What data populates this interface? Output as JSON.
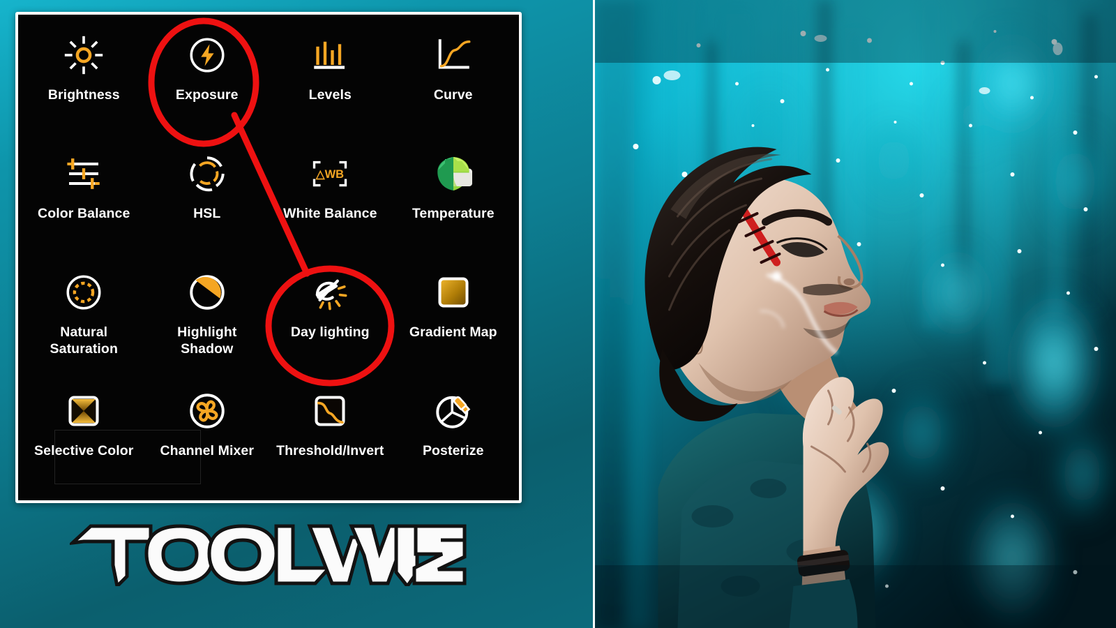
{
  "app": {
    "brand_name": "TOOLWIZ",
    "background_color": "#0d7f93",
    "panel_background": "#040404",
    "panel_border_color": "#ffffff",
    "accent_color": "#f5a623",
    "annotation_color": "#ee1111",
    "label_color": "#fdfdfd"
  },
  "tool_panel": {
    "tools": [
      {
        "label": "Brightness",
        "icon": "brightness-sun-icon",
        "highlighted": false
      },
      {
        "label": "Exposure",
        "icon": "exposure-bolt-icon",
        "highlighted": true
      },
      {
        "label": "Levels",
        "icon": "levels-histogram-icon",
        "highlighted": false
      },
      {
        "label": "Curve",
        "icon": "curve-graph-icon",
        "highlighted": false
      },
      {
        "label": "Color Balance",
        "icon": "sliders-icon",
        "highlighted": false
      },
      {
        "label": "HSL",
        "icon": "hsl-color-wheel-icon",
        "highlighted": false
      },
      {
        "label": "White Balance",
        "icon": "awb-bracket-icon",
        "highlighted": false
      },
      {
        "label": "Temperature",
        "icon": "snapseed-leaf-icon",
        "highlighted": false
      },
      {
        "label": "Natural\nSaturation",
        "icon": "dotted-circle-icon",
        "highlighted": false
      },
      {
        "label": "Highlight\nShadow",
        "icon": "half-filled-circle-icon",
        "highlighted": false
      },
      {
        "label": "Day lighting",
        "icon": "day-lighting-sun-icon",
        "highlighted": true
      },
      {
        "label": "Gradient Map",
        "icon": "gradient-square-icon",
        "highlighted": false
      },
      {
        "label": "Selective Color",
        "icon": "hourglass-square-icon",
        "highlighted": false
      },
      {
        "label": "Channel Mixer",
        "icon": "triskelion-circle-icon",
        "highlighted": false
      },
      {
        "label": "Threshold/Invert",
        "icon": "threshold-curve-square-icon",
        "highlighted": false
      },
      {
        "label": "Posterize",
        "icon": "posterize-pie-brush-icon",
        "highlighted": false
      }
    ]
  },
  "annotations": {
    "circle_exposure": {
      "target": "Exposure",
      "shape": "ellipse"
    },
    "circle_day_lighting": {
      "target": "Day lighting",
      "shape": "ellipse"
    },
    "connector": {
      "from": "Exposure",
      "to": "Day lighting",
      "shape": "line"
    }
  },
  "photo": {
    "alt": "Young man in profile looking upward against a teal rainy bokeh background",
    "watermark": "",
    "dominant_colors": [
      "#0ad0e6",
      "#0b6d80",
      "#03202a",
      "#e8e3dd"
    ]
  }
}
